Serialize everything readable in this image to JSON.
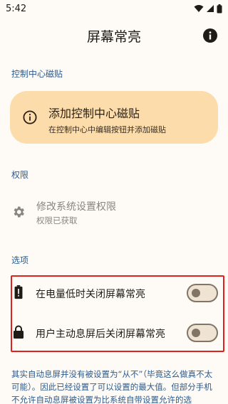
{
  "status_bar": {
    "time": "5:42"
  },
  "app_bar": {
    "title": "屏幕常亮",
    "info_icon": "info-icon"
  },
  "sections": {
    "control_center": "控制中心磁贴",
    "permissions": "权限",
    "options": "选项"
  },
  "tile_card": {
    "title": "添加控制中心磁贴",
    "subtitle": "在控制中心中编辑按钮并添加磁贴",
    "icon": "info-outline-icon",
    "background": "#fcdcab"
  },
  "permission": {
    "title": "修改系统设置权限",
    "subtitle": "权限已获取",
    "icon": "gear-icon"
  },
  "options": [
    {
      "label": "在电量低时关闭屏幕常亮",
      "icon": "battery-alert-icon",
      "enabled": false
    },
    {
      "label": "用户主动息屏后关闭屏幕常亮",
      "icon": "lock-icon",
      "enabled": false
    }
  ],
  "footnote": "其实自动息屏并没有被设置为“从不”（毕竟这么做真不太可能）。因此已经设置了可以设置的最大值。但部分手机不允许自动息屏被设置为比系统自带设置允许的选",
  "colors": {
    "background": "#fefaf6",
    "accent_blue": "#2e5b8a",
    "highlight_red": "#e0221f"
  }
}
